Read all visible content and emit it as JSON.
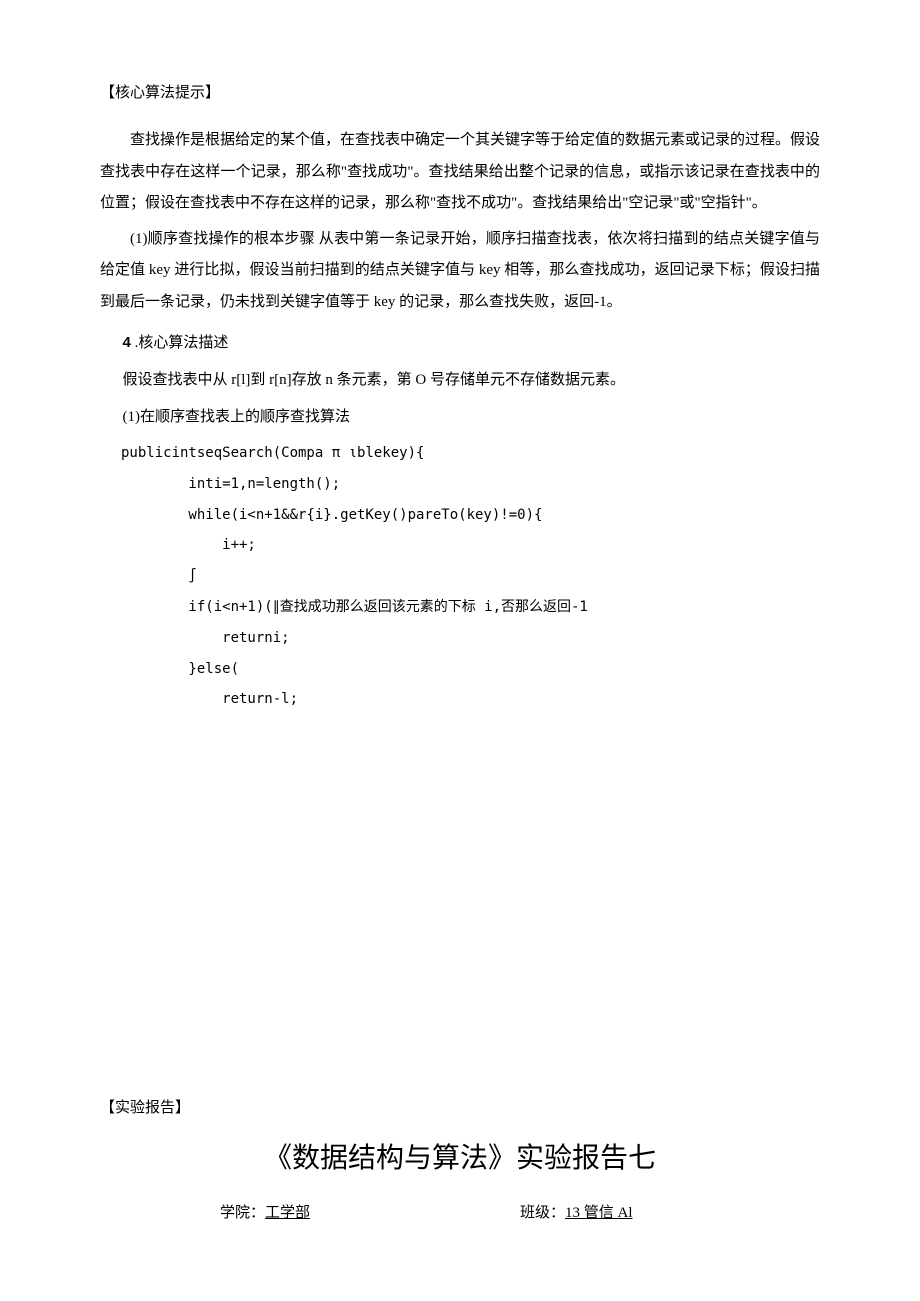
{
  "section1": {
    "heading": "【核心算法提示】",
    "p1": "查找操作是根据给定的某个值，在查找表中确定一个其关键字等于给定值的数据元素或记录的过程。假设查找表中存在这样一个记录，那么称\"查找成功\"。查找结果给出整个记录的信息，或指示该记录在查找表中的位置；假设在查找表中不存在这样的记录，那么称\"查找不成功\"。查找结果给出\"空记录\"或\"空指针\"。",
    "p2": "(1)顺序查找操作的根本步骤 从表中第一条记录开始，顺序扫描查找表，依次将扫描到的结点关键字值与给定值 key 进行比拟，假设当前扫描到的结点关键字值与 key 相等，那么查找成功，返回记录下标；假设扫描到最后一条记录，仍未找到关键字值等于 key 的记录，那么查找失败，返回-1。"
  },
  "coreAlgo": {
    "num": "4",
    "title": " .核心算法描述",
    "assume": "假设查找表中从 r[l]到 r[n]存放 n 条元素，第 O 号存储单元不存储数据元素。",
    "subitem": "(1)在顺序查找表上的顺序查找算法",
    "code": {
      "l1": "publicintseqSearch(Compa π ιblekey){",
      "l2": "        inti=1,n=length();",
      "l3": "        while(i<n+1&&r{i}.getKey()pareTo(key)!=0){",
      "l4": "            i++;",
      "l5": "        ∫",
      "l6": "        if(i<n+1)(∥查找成功那么返回该元素的下标 i,否那么返回-1",
      "l7": "            returni;",
      "l8": "        }else(",
      "l9": "            return-l;"
    }
  },
  "report": {
    "heading": "【实验报告】",
    "title": "《数据结构与算法》实验报告七",
    "collegeLabel": "学院：",
    "collegeValue": "工学部",
    "classLabel": "班级：",
    "classValue": "13 管信 Al"
  }
}
